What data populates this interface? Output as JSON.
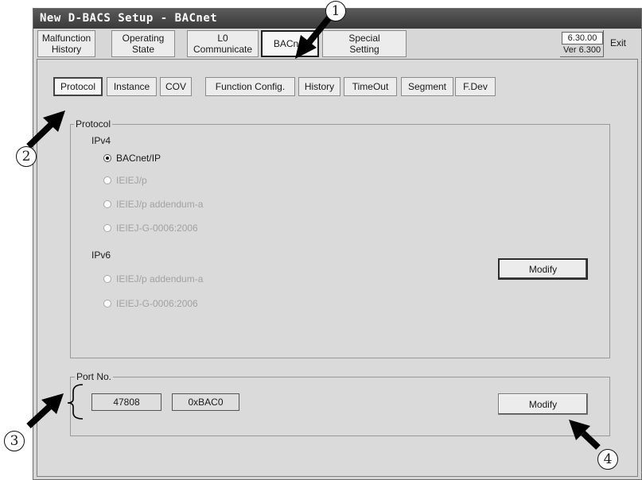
{
  "window": {
    "title": "New D-BACS Setup - BACnet",
    "menu": [
      {
        "label": "Malfunction\nHistory"
      },
      {
        "label": "Operating\nState"
      },
      {
        "label": "L0\nCommunicate"
      },
      {
        "label": "BACnet"
      },
      {
        "label": "Special\nSetting"
      }
    ],
    "version_field": "6.30.00",
    "version_text": "Ver 6.300",
    "exit_label": "Exit"
  },
  "subtabs": [
    "Protocol",
    "Instance",
    "COV",
    "Function Config.",
    "History",
    "TimeOut",
    "Segment",
    "F.Dev"
  ],
  "protocol": {
    "group_label": "Protocol",
    "ipv4_label": "IPv4",
    "ipv4_options": [
      "BACnet/IP",
      "IEIEJ/p",
      "IEIEJ/p addendum-a",
      "IEIEJ-G-0006:2006"
    ],
    "ipv6_label": "IPv6",
    "ipv6_options": [
      "IEIEJ/p addendum-a",
      "IEIEJ-G-0006:2006"
    ],
    "modify_label": "Modify"
  },
  "port": {
    "group_label": "Port No.",
    "decimal_value": "47808",
    "hex_value": "0xBAC0",
    "modify_label": "Modify"
  },
  "callouts": [
    "1",
    "2",
    "3",
    "4"
  ]
}
